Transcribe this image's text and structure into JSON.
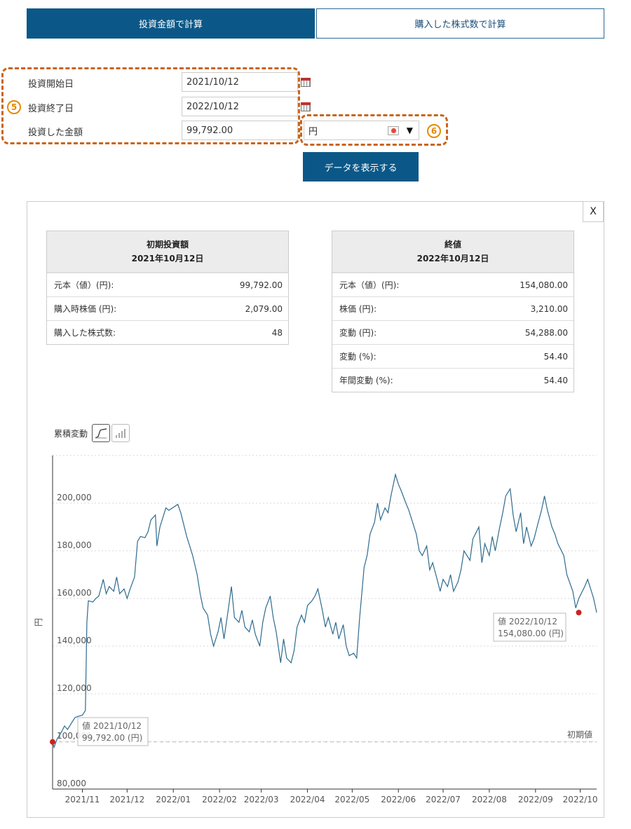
{
  "tabs": [
    {
      "label": "投資金額で計算",
      "active": true
    },
    {
      "label": "購入した株式数で計算",
      "active": false
    }
  ],
  "form": {
    "start_label": "投資開始日",
    "start_value": "2021/10/12",
    "end_label": "投資終了日",
    "end_value": "2022/10/12",
    "amount_label": "投資した金額",
    "amount_value": "99,792.00",
    "currency": "円",
    "marker_5": "5",
    "marker_6": "6"
  },
  "show_button": "データを表示する",
  "close_label": "X",
  "initial_table": {
    "title": "初期投資額",
    "date": "2021年10月12日",
    "rows": [
      {
        "label": "元本（値）(円):",
        "value": "99,792.00"
      },
      {
        "label": "購入時株価 (円):",
        "value": "2,079.00"
      },
      {
        "label": "購入した株式数:",
        "value": "48"
      }
    ]
  },
  "final_table": {
    "title": "終値",
    "date": "2022年10月12日",
    "rows": [
      {
        "label": "元本（値）(円):",
        "value": "154,080.00"
      },
      {
        "label": "株価 (円):",
        "value": "3,210.00"
      },
      {
        "label": "変動 (円):",
        "value": "54,288.00"
      },
      {
        "label": "変動 (%):",
        "value": "54.40"
      },
      {
        "label": "年間変動 (%):",
        "value": "54.40"
      }
    ]
  },
  "chart_toolbar": {
    "label": "累積変動",
    "line_icon": "line-chart-icon",
    "bar_icon": "bar-chart-icon"
  },
  "colors": {
    "accent": "#0b5888",
    "line": "#2e6b8e",
    "marker": "#cc2222",
    "highlight": "#c8651b"
  },
  "chart_data": {
    "type": "line",
    "ylabel": "円",
    "ylim": [
      80000,
      220000
    ],
    "yticks": [
      80000,
      100000,
      120000,
      140000,
      160000,
      180000,
      200000
    ],
    "ytick_labels": [
      "80,000",
      "100,000",
      "120,000",
      "140,000",
      "160,000",
      "180,000",
      "200,000"
    ],
    "xlim": [
      "2021-10-12",
      "2022-10-12"
    ],
    "xticks": [
      "2021-11-01",
      "2021-12-01",
      "2022-01-01",
      "2022-02-01",
      "2022-03-01",
      "2022-04-01",
      "2022-05-01",
      "2022-06-01",
      "2022-07-01",
      "2022-08-01",
      "2022-09-01",
      "2022-10-01"
    ],
    "xtick_labels": [
      "2021/11",
      "2021/12",
      "2022/01",
      "2022/02",
      "2022/03",
      "2022/04",
      "2022/05",
      "2022/06",
      "2022/07",
      "2022/08",
      "2022/09",
      "2022/10"
    ],
    "reference": {
      "value": 99792,
      "label": "初期値"
    },
    "start_tooltip": {
      "date": "2021-10-12",
      "value": 99792,
      "line1": "値 2021/10/12",
      "line2": "99,792.00 (円)"
    },
    "end_tooltip": {
      "date": "2022-09-30",
      "value": 154080,
      "line1": "値 2022/10/12",
      "line2": "154,080.00 (円)"
    },
    "series": [
      {
        "points": [
          [
            "2021-10-12",
            99792
          ],
          [
            "2021-10-13",
            97500
          ],
          [
            "2021-10-15",
            101000
          ],
          [
            "2021-10-18",
            104000
          ],
          [
            "2021-10-20",
            106500
          ],
          [
            "2021-10-22",
            105000
          ],
          [
            "2021-10-25",
            108000
          ],
          [
            "2021-10-27",
            110000
          ],
          [
            "2021-10-29",
            110500
          ],
          [
            "2021-11-01",
            111000
          ],
          [
            "2021-11-03",
            113000
          ],
          [
            "2021-11-04",
            150000
          ],
          [
            "2021-11-05",
            159000
          ],
          [
            "2021-11-08",
            158500
          ],
          [
            "2021-11-10",
            160000
          ],
          [
            "2021-11-12",
            161000
          ],
          [
            "2021-11-15",
            168000
          ],
          [
            "2021-11-17",
            162000
          ],
          [
            "2021-11-19",
            165000
          ],
          [
            "2021-11-22",
            163000
          ],
          [
            "2021-11-24",
            169000
          ],
          [
            "2021-11-26",
            162000
          ],
          [
            "2021-11-29",
            164000
          ],
          [
            "2021-12-01",
            160000
          ],
          [
            "2021-12-03",
            164000
          ],
          [
            "2021-12-06",
            169000
          ],
          [
            "2021-12-08",
            184000
          ],
          [
            "2021-12-10",
            186000
          ],
          [
            "2021-12-13",
            185500
          ],
          [
            "2021-12-15",
            188000
          ],
          [
            "2021-12-17",
            193000
          ],
          [
            "2021-12-20",
            195000
          ],
          [
            "2021-12-21",
            182000
          ],
          [
            "2021-12-23",
            190000
          ],
          [
            "2021-12-27",
            198000
          ],
          [
            "2021-12-29",
            197000
          ],
          [
            "2022-01-04",
            199500
          ],
          [
            "2022-01-06",
            196000
          ],
          [
            "2022-01-10",
            186000
          ],
          [
            "2022-01-12",
            182000
          ],
          [
            "2022-01-14",
            178000
          ],
          [
            "2022-01-17",
            170000
          ],
          [
            "2022-01-19",
            162000
          ],
          [
            "2022-01-21",
            156000
          ],
          [
            "2022-01-24",
            153000
          ],
          [
            "2022-01-26",
            145000
          ],
          [
            "2022-01-28",
            140000
          ],
          [
            "2022-01-31",
            146000
          ],
          [
            "2022-02-02",
            152000
          ],
          [
            "2022-02-04",
            143000
          ],
          [
            "2022-02-07",
            156000
          ],
          [
            "2022-02-09",
            165000
          ],
          [
            "2022-02-11",
            152000
          ],
          [
            "2022-02-14",
            150000
          ],
          [
            "2022-02-16",
            155000
          ],
          [
            "2022-02-18",
            148000
          ],
          [
            "2022-02-21",
            146000
          ],
          [
            "2022-02-23",
            151000
          ],
          [
            "2022-02-25",
            145000
          ],
          [
            "2022-02-28",
            140000
          ],
          [
            "2022-03-02",
            150000
          ],
          [
            "2022-03-04",
            156000
          ],
          [
            "2022-03-07",
            161000
          ],
          [
            "2022-03-09",
            152000
          ],
          [
            "2022-03-11",
            146000
          ],
          [
            "2022-03-14",
            133000
          ],
          [
            "2022-03-16",
            143000
          ],
          [
            "2022-03-18",
            135000
          ],
          [
            "2022-03-21",
            133000
          ],
          [
            "2022-03-23",
            138000
          ],
          [
            "2022-03-25",
            148000
          ],
          [
            "2022-03-28",
            153000
          ],
          [
            "2022-03-30",
            150000
          ],
          [
            "2022-04-01",
            157000
          ],
          [
            "2022-04-04",
            159000
          ],
          [
            "2022-04-06",
            161000
          ],
          [
            "2022-04-08",
            164000
          ],
          [
            "2022-04-11",
            155000
          ],
          [
            "2022-04-13",
            148000
          ],
          [
            "2022-04-15",
            152000
          ],
          [
            "2022-04-18",
            145000
          ],
          [
            "2022-04-20",
            150000
          ],
          [
            "2022-04-22",
            143000
          ],
          [
            "2022-04-25",
            149000
          ],
          [
            "2022-04-27",
            140000
          ],
          [
            "2022-04-29",
            136000
          ],
          [
            "2022-05-02",
            137000
          ],
          [
            "2022-05-04",
            135000
          ],
          [
            "2022-05-06",
            152000
          ],
          [
            "2022-05-09",
            173000
          ],
          [
            "2022-05-11",
            178000
          ],
          [
            "2022-05-13",
            187000
          ],
          [
            "2022-05-16",
            192000
          ],
          [
            "2022-05-18",
            200000
          ],
          [
            "2022-05-20",
            193000
          ],
          [
            "2022-05-23",
            198000
          ],
          [
            "2022-05-25",
            196000
          ],
          [
            "2022-05-27",
            203000
          ],
          [
            "2022-05-30",
            212000
          ],
          [
            "2022-06-01",
            208000
          ],
          [
            "2022-06-03",
            205000
          ],
          [
            "2022-06-06",
            200000
          ],
          [
            "2022-06-08",
            197000
          ],
          [
            "2022-06-10",
            193000
          ],
          [
            "2022-06-13",
            187000
          ],
          [
            "2022-06-15",
            180000
          ],
          [
            "2022-06-17",
            178000
          ],
          [
            "2022-06-20",
            182000
          ],
          [
            "2022-06-22",
            172000
          ],
          [
            "2022-06-24",
            175000
          ],
          [
            "2022-06-27",
            168000
          ],
          [
            "2022-06-29",
            163000
          ],
          [
            "2022-07-01",
            168000
          ],
          [
            "2022-07-04",
            165000
          ],
          [
            "2022-07-06",
            170000
          ],
          [
            "2022-07-08",
            163000
          ],
          [
            "2022-07-11",
            167000
          ],
          [
            "2022-07-13",
            172000
          ],
          [
            "2022-07-15",
            180000
          ],
          [
            "2022-07-19",
            176000
          ],
          [
            "2022-07-21",
            185000
          ],
          [
            "2022-07-25",
            190000
          ],
          [
            "2022-07-27",
            175000
          ],
          [
            "2022-07-29",
            183000
          ],
          [
            "2022-08-01",
            178000
          ],
          [
            "2022-08-03",
            186000
          ],
          [
            "2022-08-05",
            180000
          ],
          [
            "2022-08-08",
            190000
          ],
          [
            "2022-08-10",
            196000
          ],
          [
            "2022-08-12",
            203000
          ],
          [
            "2022-08-15",
            206000
          ],
          [
            "2022-08-17",
            195000
          ],
          [
            "2022-08-19",
            188000
          ],
          [
            "2022-08-22",
            196000
          ],
          [
            "2022-08-24",
            183000
          ],
          [
            "2022-08-26",
            190000
          ],
          [
            "2022-08-29",
            182000
          ],
          [
            "2022-08-31",
            185000
          ],
          [
            "2022-09-02",
            190000
          ],
          [
            "2022-09-05",
            197000
          ],
          [
            "2022-09-07",
            203000
          ],
          [
            "2022-09-09",
            197000
          ],
          [
            "2022-09-12",
            190000
          ],
          [
            "2022-09-14",
            187000
          ],
          [
            "2022-09-16",
            183000
          ],
          [
            "2022-09-20",
            178000
          ],
          [
            "2022-09-22",
            170000
          ],
          [
            "2022-09-26",
            163000
          ],
          [
            "2022-09-28",
            156000
          ],
          [
            "2022-09-30",
            160000
          ],
          [
            "2022-10-04",
            165000
          ],
          [
            "2022-10-06",
            168000
          ],
          [
            "2022-10-10",
            160000
          ],
          [
            "2022-10-12",
            154080
          ]
        ]
      }
    ]
  }
}
